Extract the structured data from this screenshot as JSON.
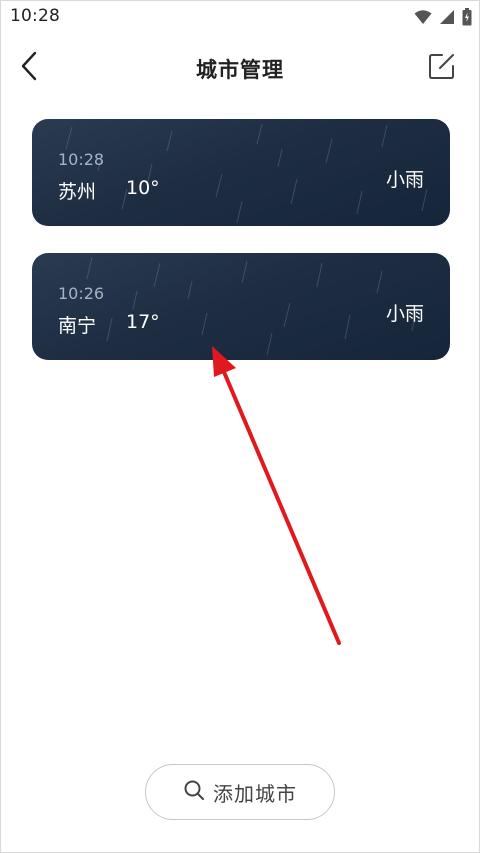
{
  "status_bar": {
    "time": "10:28",
    "icons": [
      "wifi-icon",
      "signal-icon",
      "battery-icon"
    ]
  },
  "header": {
    "title": "城市管理",
    "back_icon": "chevron-left-icon",
    "edit_icon": "edit-icon"
  },
  "cities": [
    {
      "time": "10:28",
      "name": "苏州",
      "temperature": "10°",
      "weather": "小雨"
    },
    {
      "time": "10:26",
      "name": "南宁",
      "temperature": "17°",
      "weather": "小雨"
    }
  ],
  "add_button": {
    "label": "添加城市",
    "icon": "search-icon"
  },
  "colors": {
    "card_background": "#1e2d42",
    "annotation_arrow": "#e0191f",
    "title_text": "#222222"
  }
}
